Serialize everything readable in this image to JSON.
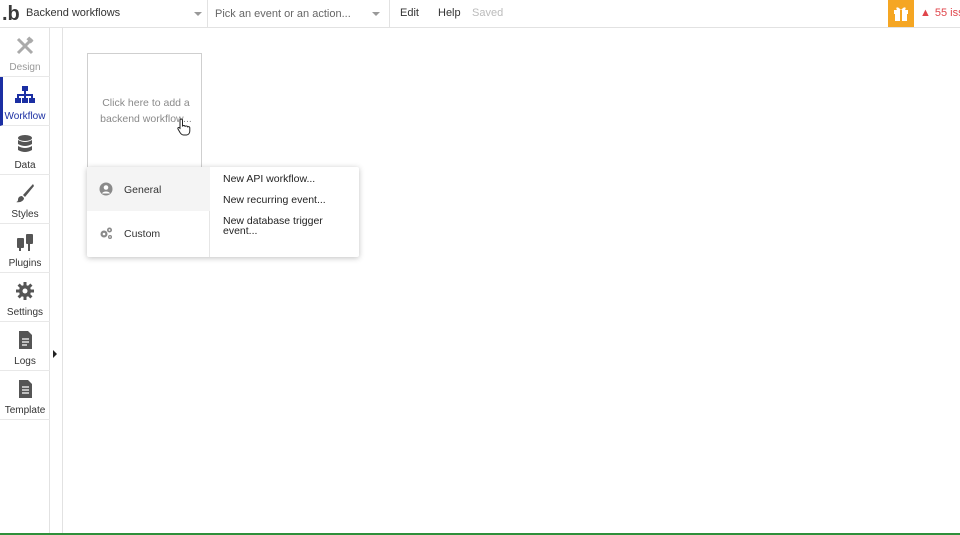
{
  "app": {
    "logo_text": ".b"
  },
  "topbar": {
    "page_selector": "Backend workflows",
    "event_placeholder": "Pick an event or an action...",
    "edit_label": "Edit",
    "help_label": "Help",
    "saved_label": "Saved",
    "issues_label": "55 iss",
    "gift_color": "#f5a623",
    "issues_color": "#e0454b"
  },
  "sidebar": {
    "accent_color": "#1b2fa3",
    "items": [
      {
        "label": "Design",
        "icon": "design-icon"
      },
      {
        "label": "Workflow",
        "icon": "workflow-icon"
      },
      {
        "label": "Data",
        "icon": "database-icon"
      },
      {
        "label": "Styles",
        "icon": "brush-icon"
      },
      {
        "label": "Plugins",
        "icon": "plugin-icon"
      },
      {
        "label": "Settings",
        "icon": "gear-icon"
      },
      {
        "label": "Logs",
        "icon": "document-icon"
      },
      {
        "label": "Template",
        "icon": "template-icon"
      }
    ]
  },
  "canvas": {
    "add_workflow_text": "Click here to add a backend workflow..."
  },
  "popup": {
    "categories": [
      {
        "label": "General",
        "icon": "user-circle-icon"
      },
      {
        "label": "Custom",
        "icon": "gears-icon"
      }
    ],
    "options": [
      "New API workflow...",
      "New recurring event...",
      "New database trigger event..."
    ]
  }
}
